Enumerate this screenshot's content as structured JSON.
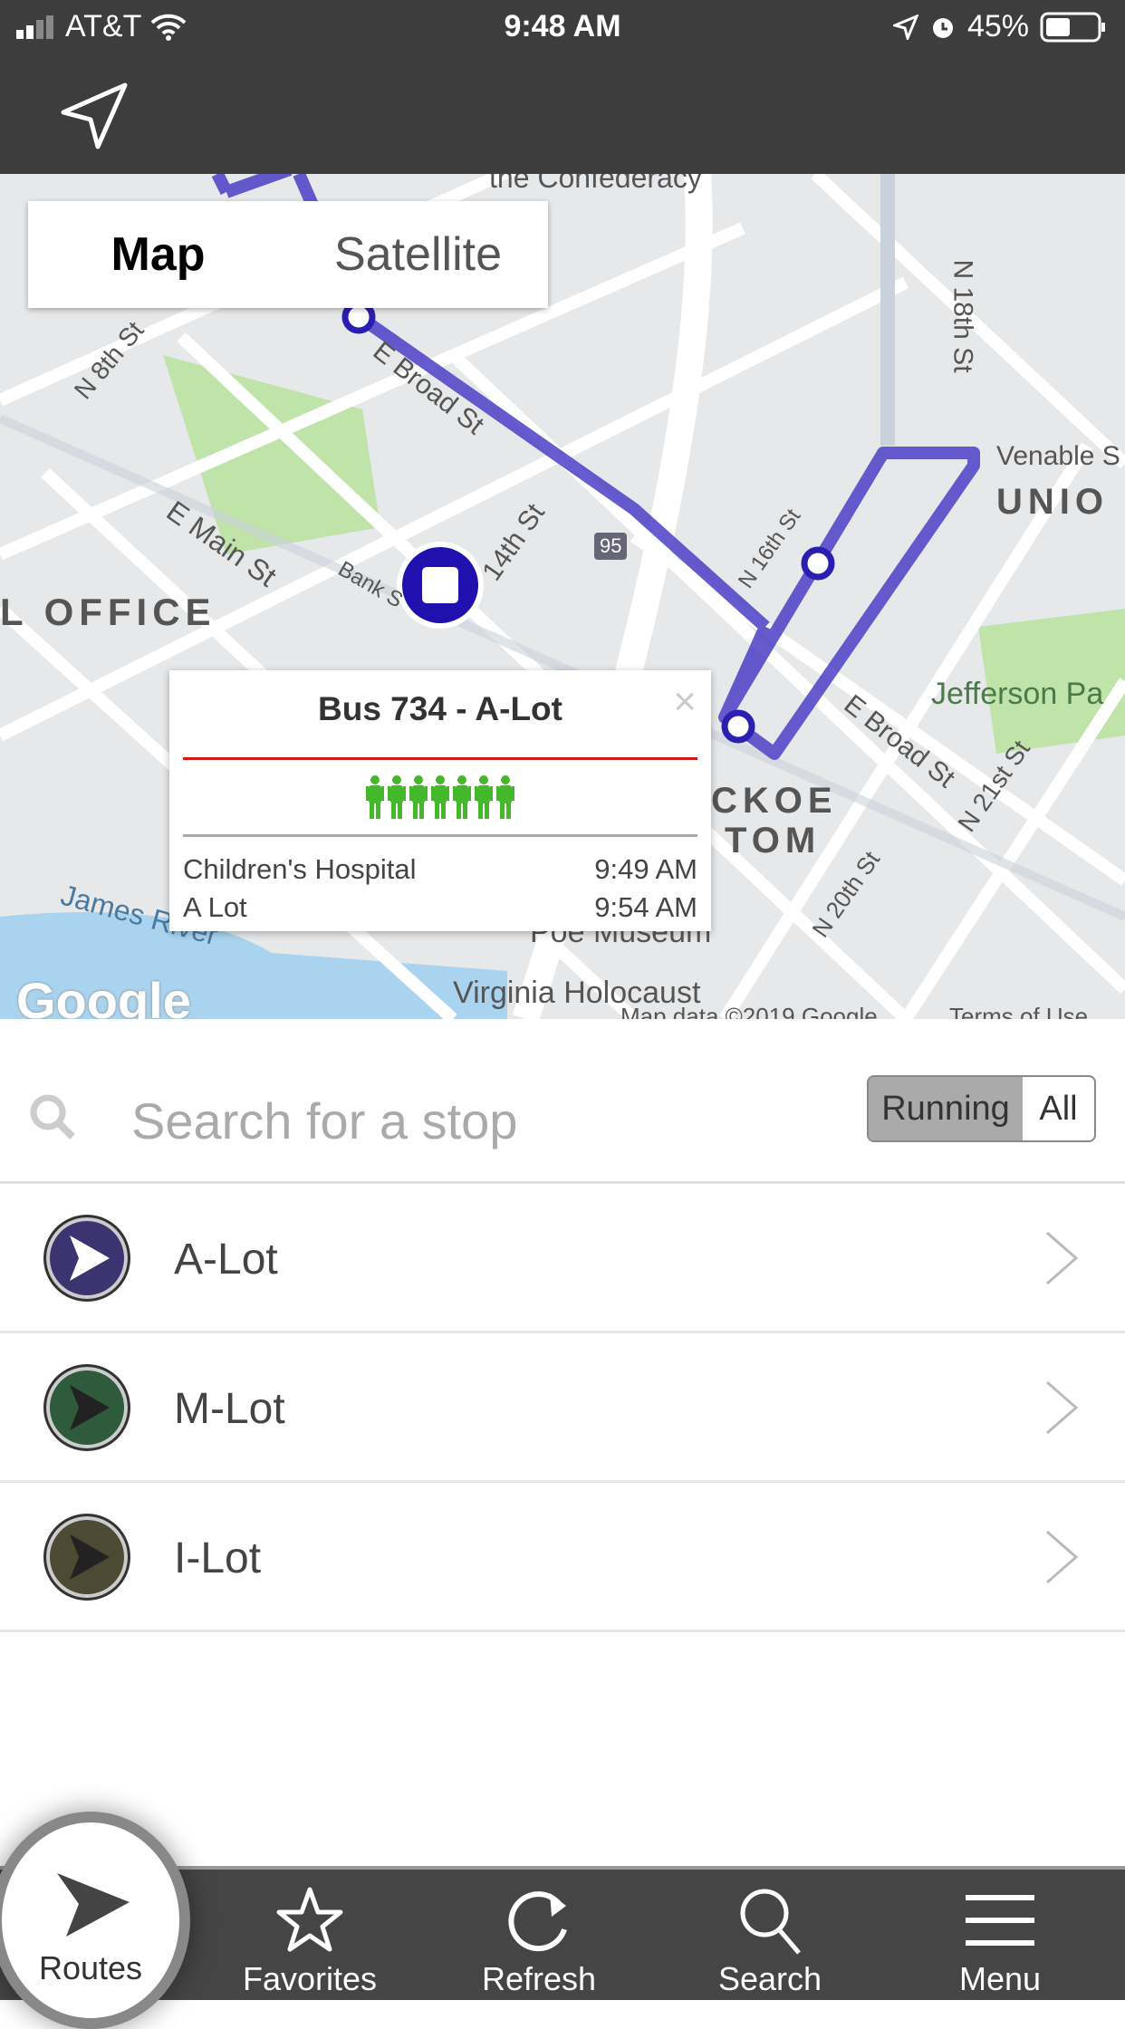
{
  "status_bar": {
    "carrier": "AT&T",
    "time": "9:48 AM",
    "battery": "45%"
  },
  "header": {
    "icon": "location-arrow-icon"
  },
  "map": {
    "type_toggle": [
      "Map",
      "Satellite"
    ],
    "selected": "Map",
    "labels": {
      "n8": "N 8th St",
      "main": "E Main St",
      "broad": "E Broad St",
      "broad2": "E Broad St",
      "office": "L OFFICE",
      "union": "UNIO",
      "venable": "Venable S",
      "jefferson": "Jefferson Pa",
      "n18": "N 18th St",
      "n21": "N 21st St",
      "n20": "N 20th St",
      "n16": "N 16th St",
      "n14": "14th St",
      "bank": "Bank S",
      "james": "James River",
      "poe": "Poe Museum",
      "holocaust": "Virginia Holocaust",
      "shockoe": "CKOE",
      "bottom": "TOM",
      "confed": "the Confederacy",
      "i95": "95",
      "google": "Google",
      "mapdata": "Map data ©2019 Google",
      "terms": "Terms of Use"
    },
    "route_color": "#4b3fc7"
  },
  "popup": {
    "title": "Bus 734 - A-Lot",
    "close": "×",
    "occupancy_icons": 7,
    "occupancy_glyphs": "🚹🚹🚹🚹🚹🚹🚹",
    "stops": [
      {
        "name": "Children's Hospital",
        "time": "9:49 AM"
      },
      {
        "name": "A Lot",
        "time": "9:54 AM"
      }
    ]
  },
  "search": {
    "placeholder": "Search for a stop",
    "filter": [
      "Running",
      "All"
    ],
    "selected": "Running"
  },
  "routes": [
    {
      "label": "A-Lot",
      "color": "#3b3470"
    },
    {
      "label": "M-Lot",
      "color": "#2f5a3c"
    },
    {
      "label": "I-Lot",
      "color": "#4d4a34"
    }
  ],
  "nav": [
    {
      "label": "Routes",
      "icon": "route-arrow-icon"
    },
    {
      "label": "Favorites",
      "icon": "star-icon"
    },
    {
      "label": "Refresh",
      "icon": "refresh-icon"
    },
    {
      "label": "Search",
      "icon": "search-icon"
    },
    {
      "label": "Menu",
      "icon": "menu-icon"
    }
  ]
}
